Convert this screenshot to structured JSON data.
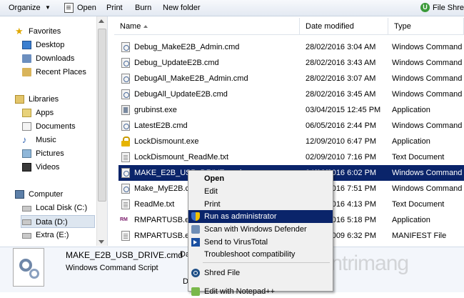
{
  "toolbar": {
    "organize": "Organize",
    "open": "Open",
    "print": "Print",
    "burn": "Burn",
    "new_folder": "New folder",
    "right_item": "File Shred"
  },
  "nav": {
    "favorites": "Favorites",
    "desktop": "Desktop",
    "downloads": "Downloads",
    "recent": "Recent Places",
    "libraries": "Libraries",
    "apps": "Apps",
    "documents": "Documents",
    "music": "Music",
    "pictures": "Pictures",
    "videos": "Videos",
    "computer": "Computer",
    "local_disk": "Local Disk (C:)",
    "data": "Data (D:)",
    "extra": "Extra (E:)"
  },
  "columns": {
    "name": "Name",
    "date": "Date modified",
    "type": "Type"
  },
  "files": [
    {
      "name": "Debug_MakeE2B_Admin.cmd",
      "date": "28/02/2016 3:04 AM",
      "type": "Windows Command ...",
      "icon": "gear"
    },
    {
      "name": "Debug_UpdateE2B.cmd",
      "date": "28/02/2016 3:43 AM",
      "type": "Windows Command ...",
      "icon": "gear"
    },
    {
      "name": "DebugAll_MakeE2B_Admin.cmd",
      "date": "28/02/2016 3:07 AM",
      "type": "Windows Command ...",
      "icon": "gear"
    },
    {
      "name": "DebugAll_UpdateE2B.cmd",
      "date": "28/02/2016 3:45 AM",
      "type": "Windows Command ...",
      "icon": "gear"
    },
    {
      "name": "grubinst.exe",
      "date": "03/04/2015 12:45 PM",
      "type": "Application",
      "icon": "app"
    },
    {
      "name": "LatestE2B.cmd",
      "date": "06/05/2016 2:44 PM",
      "type": "Windows Command ...",
      "icon": "gear"
    },
    {
      "name": "LockDismount.exe",
      "date": "12/09/2010 6:47 PM",
      "type": "Application",
      "icon": "lock"
    },
    {
      "name": "LockDismount_ReadMe.txt",
      "date": "02/09/2010 7:16 PM",
      "type": "Text Document",
      "icon": "txt"
    },
    {
      "name": "MAKE_E2B_USB_DRIVE.cmd",
      "date": "04/06/2016 6:02 PM",
      "type": "Windows Command ...",
      "icon": "gear"
    },
    {
      "name": "Make_MyE2B.cmd",
      "date": "28/02/2016 7:51 PM",
      "type": "Windows Command ...",
      "icon": "gear"
    },
    {
      "name": "ReadMe.txt",
      "date": "28/02/2016 4:13 PM",
      "type": "Text Document",
      "icon": "txt"
    },
    {
      "name": "RMPARTUSB.exe",
      "date": "28/02/2016 5:18 PM",
      "type": "Application",
      "icon": "rm"
    },
    {
      "name": "RMPARTUSB.exe.manifest",
      "date": "28/02/2009 6:32 PM",
      "type": "MANIFEST File",
      "icon": "txt"
    }
  ],
  "selected_index": 8,
  "details": {
    "name": "MAKE_E2B_USB_DRIVE.cmd",
    "label_suffix": "Da",
    "type": "Windows Command Script",
    "bottom_letter": "D"
  },
  "context_menu": {
    "open": "Open",
    "edit": "Edit",
    "print": "Print",
    "run_admin": "Run as administrator",
    "defender": "Scan with Windows Defender",
    "virustotal": "Send to VirusTotal",
    "troubleshoot": "Troubleshoot compatibility",
    "shred": "Shred File",
    "notepad": "Edit with Notepad++"
  },
  "watermark": "uantrimang",
  "colors": {
    "selection": "#0a246a",
    "highlight_text": "#ffffff"
  }
}
